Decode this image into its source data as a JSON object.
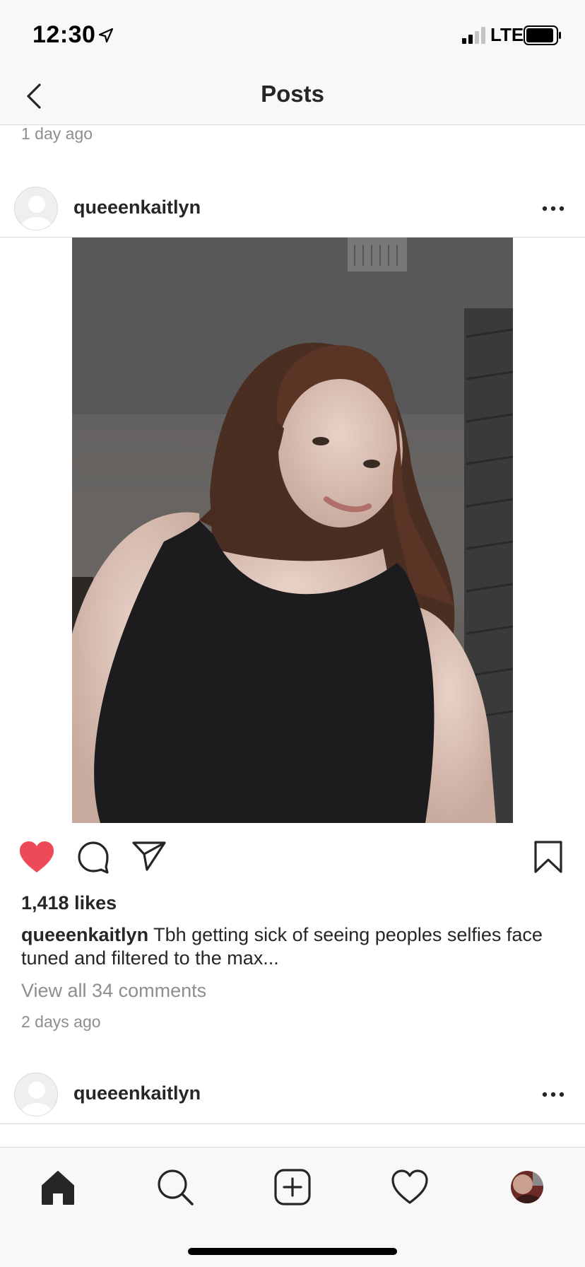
{
  "status_bar": {
    "time": "12:30",
    "network": "LTE"
  },
  "nav": {
    "title": "Posts"
  },
  "previous_post": {
    "time": "1 day ago"
  },
  "post": {
    "username": "queeenkaitlyn",
    "likes": "1,418 likes",
    "caption_user": "queeenkaitlyn",
    "caption_text": "Tbh getting sick of seeing peoples selfies face tuned and filtered to the max...",
    "view_comments": "View all 34 comments",
    "time": "2 days ago",
    "liked": true
  },
  "next_post": {
    "username": "queeenkaitlyn"
  },
  "tabs": [
    {
      "name": "home",
      "icon": "home-icon",
      "active": true
    },
    {
      "name": "search",
      "icon": "search-icon"
    },
    {
      "name": "new-post",
      "icon": "add-post-icon"
    },
    {
      "name": "activity",
      "icon": "heart-icon"
    },
    {
      "name": "profile",
      "icon": "profile-avatar"
    }
  ],
  "colors": {
    "like_red": "#ed4956",
    "text": "#262626",
    "muted": "#8e8e8e",
    "divider": "#dbdbdb",
    "bar_bg": "#f8f8f8"
  }
}
